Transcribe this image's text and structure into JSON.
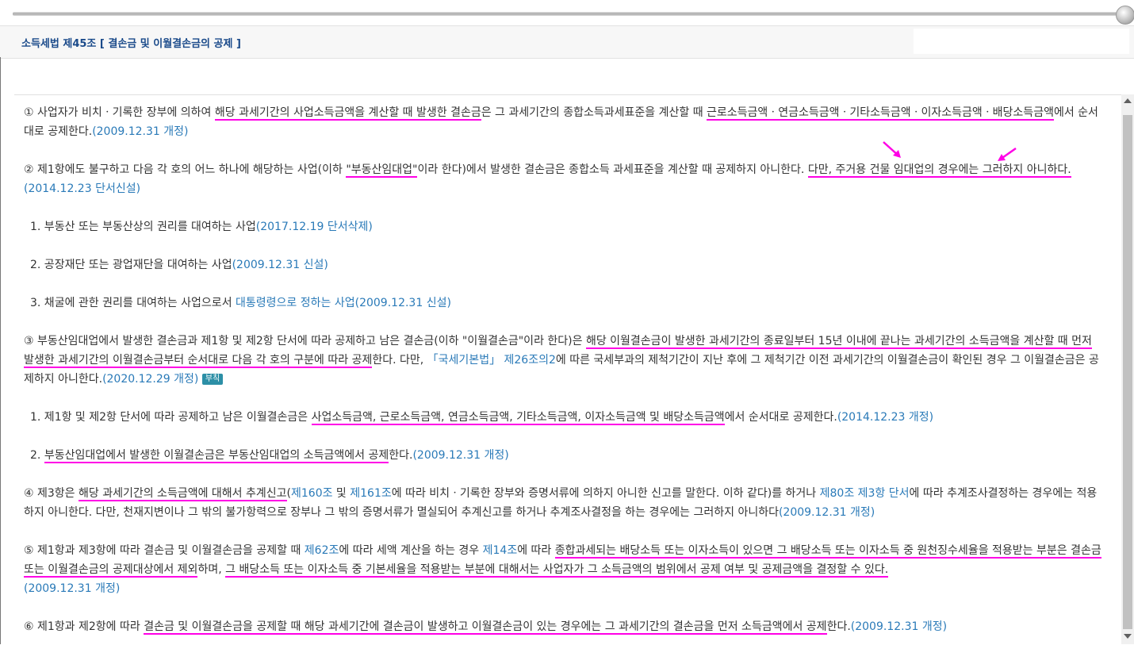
{
  "header": {
    "title": "소득세법 제45조 [ 결손금 및 이월결손금의 공제 ]"
  },
  "p1": {
    "a": "① 사업자가 비치ㆍ기록한 장부에 의하여 ",
    "u1": "해당 과세기간의 사업소득금액을 계산할 때 발생한 결손금",
    "b": "은 그 과세기간의 종합소득과세표준을 계산할 때 ",
    "u2": "근로소득금액ㆍ연금소득금액ㆍ기타소득금액ㆍ이자소득금액ㆍ배당소득금액",
    "c": "에서 순서대로 공제한다.",
    "amend": "(2009.12.31 개정)"
  },
  "p2": {
    "a": "② 제1항에도 불구하고 다음 각 호의 어느 하나에 해당하는 사업(이하 ",
    "u1": "\"부동산임대업\"",
    "b": "이라 한다)에서 발생한 결손금은 종합소득 과세표준을 계산할 때 공제하지 아니한다. ",
    "u2": "다만, 주거용 건물 임대업의 경우에는 그러하지 아니하다.",
    "amend": "(2014.12.23 단서신설)"
  },
  "p2_items": [
    {
      "text": "1. 부동산 또는 부동산상의 권리를 대여하는 사업",
      "amend": "(2017.12.19 단서삭제)"
    },
    {
      "text": "2. 공장재단 또는 광업재단을 대여하는 사업",
      "amend": "(2009.12.31 신설)"
    },
    {
      "text": "3. 채굴에 관한 권리를 대여하는 사업으로서 ",
      "link": "대통령령으로 정하는 사업",
      "amend": "(2009.12.31 신설)"
    }
  ],
  "p3": {
    "a": "③ 부동산임대업에서 발생한 결손금과 제1항 및 제2항 단서에 따라 공제하고 남은 결손금(이하 \"이월결손금\"이라 한다)은 ",
    "u1": "해당 이월결손금이 발생한 과세기간의 종료일부터 15년 이내에 끝나는 과세기간의 소득금액을 계산할 때 먼저 발생한 과세기간의 이월결손금부터 순서대로 다음 각 호의 구분에 따라 공제",
    "b": "한다. 다만, ",
    "link": "「국세기본법」 제26조의2",
    "c": "에 따른 국세부과의 제척기간이 지난 후에 그 제척기간 이전 과세기간의 이월결손금이 확인된 경우 그 이월결손금은 공제하지 아니한다.",
    "amend": "(2020.12.29 개정)",
    "badge": "부칙"
  },
  "p3_items": [
    {
      "a": "1. 제1항 및 제2항 단서에 따라 공제하고 남은 이월결손금은 ",
      "u": "사업소득금액, 근로소득금액, 연금소득금액, 기타소득금액, 이자소득금액 및 배당소득금액",
      "b": "에서 순서대로 공제한다.",
      "amend": "(2014.12.23 개정)"
    },
    {
      "a": "2. ",
      "u": "부동산임대업에서 발생한 이월결손금은 부동산임대업의 소득금액에서 공제",
      "b": "한다.",
      "amend": "(2009.12.31 개정)"
    }
  ],
  "p4": {
    "a": "④ 제3항은 ",
    "u1": "해당 과세기간의 소득금액에 대해서 추계신고",
    "b": "(",
    "l1": "제160조",
    "c": " 및 ",
    "l2": "제161조",
    "d": "에 따라 비치ㆍ기록한 장부와 증명서류에 의하지 아니한 신고를 말한다. 이하 같다)를 하거나 ",
    "l3": "제80조 제3항 단서",
    "e": "에 따라 추계조사결정하는 경우에는 적용하지 아니한다. 다만, 천재지변이나 그 밖의 불가항력으로 장부나 그 밖의 증명서류가 멸실되어 추계신고를 하거나 추계조사결정을 하는 경우에는 그러하지 아니하다",
    "amend": "(2009.12.31 개정)"
  },
  "p5": {
    "a": "⑤ 제1항과 제3항에 따라 결손금 및 이월결손금을 공제할 때 ",
    "l1": "제62조",
    "b": "에 따라 세액 계산을 하는 경우 ",
    "l2": "제14조",
    "c": "에 따라 ",
    "u1": "종합과세되는 배당소득 또는 이자소득이 있으면 그 배당소득 또는 이자소득 중 원천징수세율을 적용받는 부분은 결손금 또는 이월결손금의 공제대상에서 제외",
    "d": "하며, ",
    "u2": "그 배당소득 또는 이자소득 중 기본세율을 적용받는 부분에 대해서는 사업자가 그 소득금액의 범위에서 공제 여부 및 공제금액을 결정할 수 있다.",
    "amend": "(2009.12.31 개정)"
  },
  "p6": {
    "a": "⑥ 제1항과 제2항에 따라 ",
    "u1": "결손금 및 이월결손금을 공제할 때 해당 과세기간에 결손금이 발생하고 이월결손금이 있는 경우에는 그 과세기간의 결손금을 먼저 소득금액에서 공제",
    "b": "한다.",
    "amend": "(2009.12.31 개정)"
  },
  "colors": {
    "underline": "#ff00e6",
    "link": "#2a7ab8",
    "title": "#1a4a8a",
    "badge": "#2c8fa6"
  }
}
